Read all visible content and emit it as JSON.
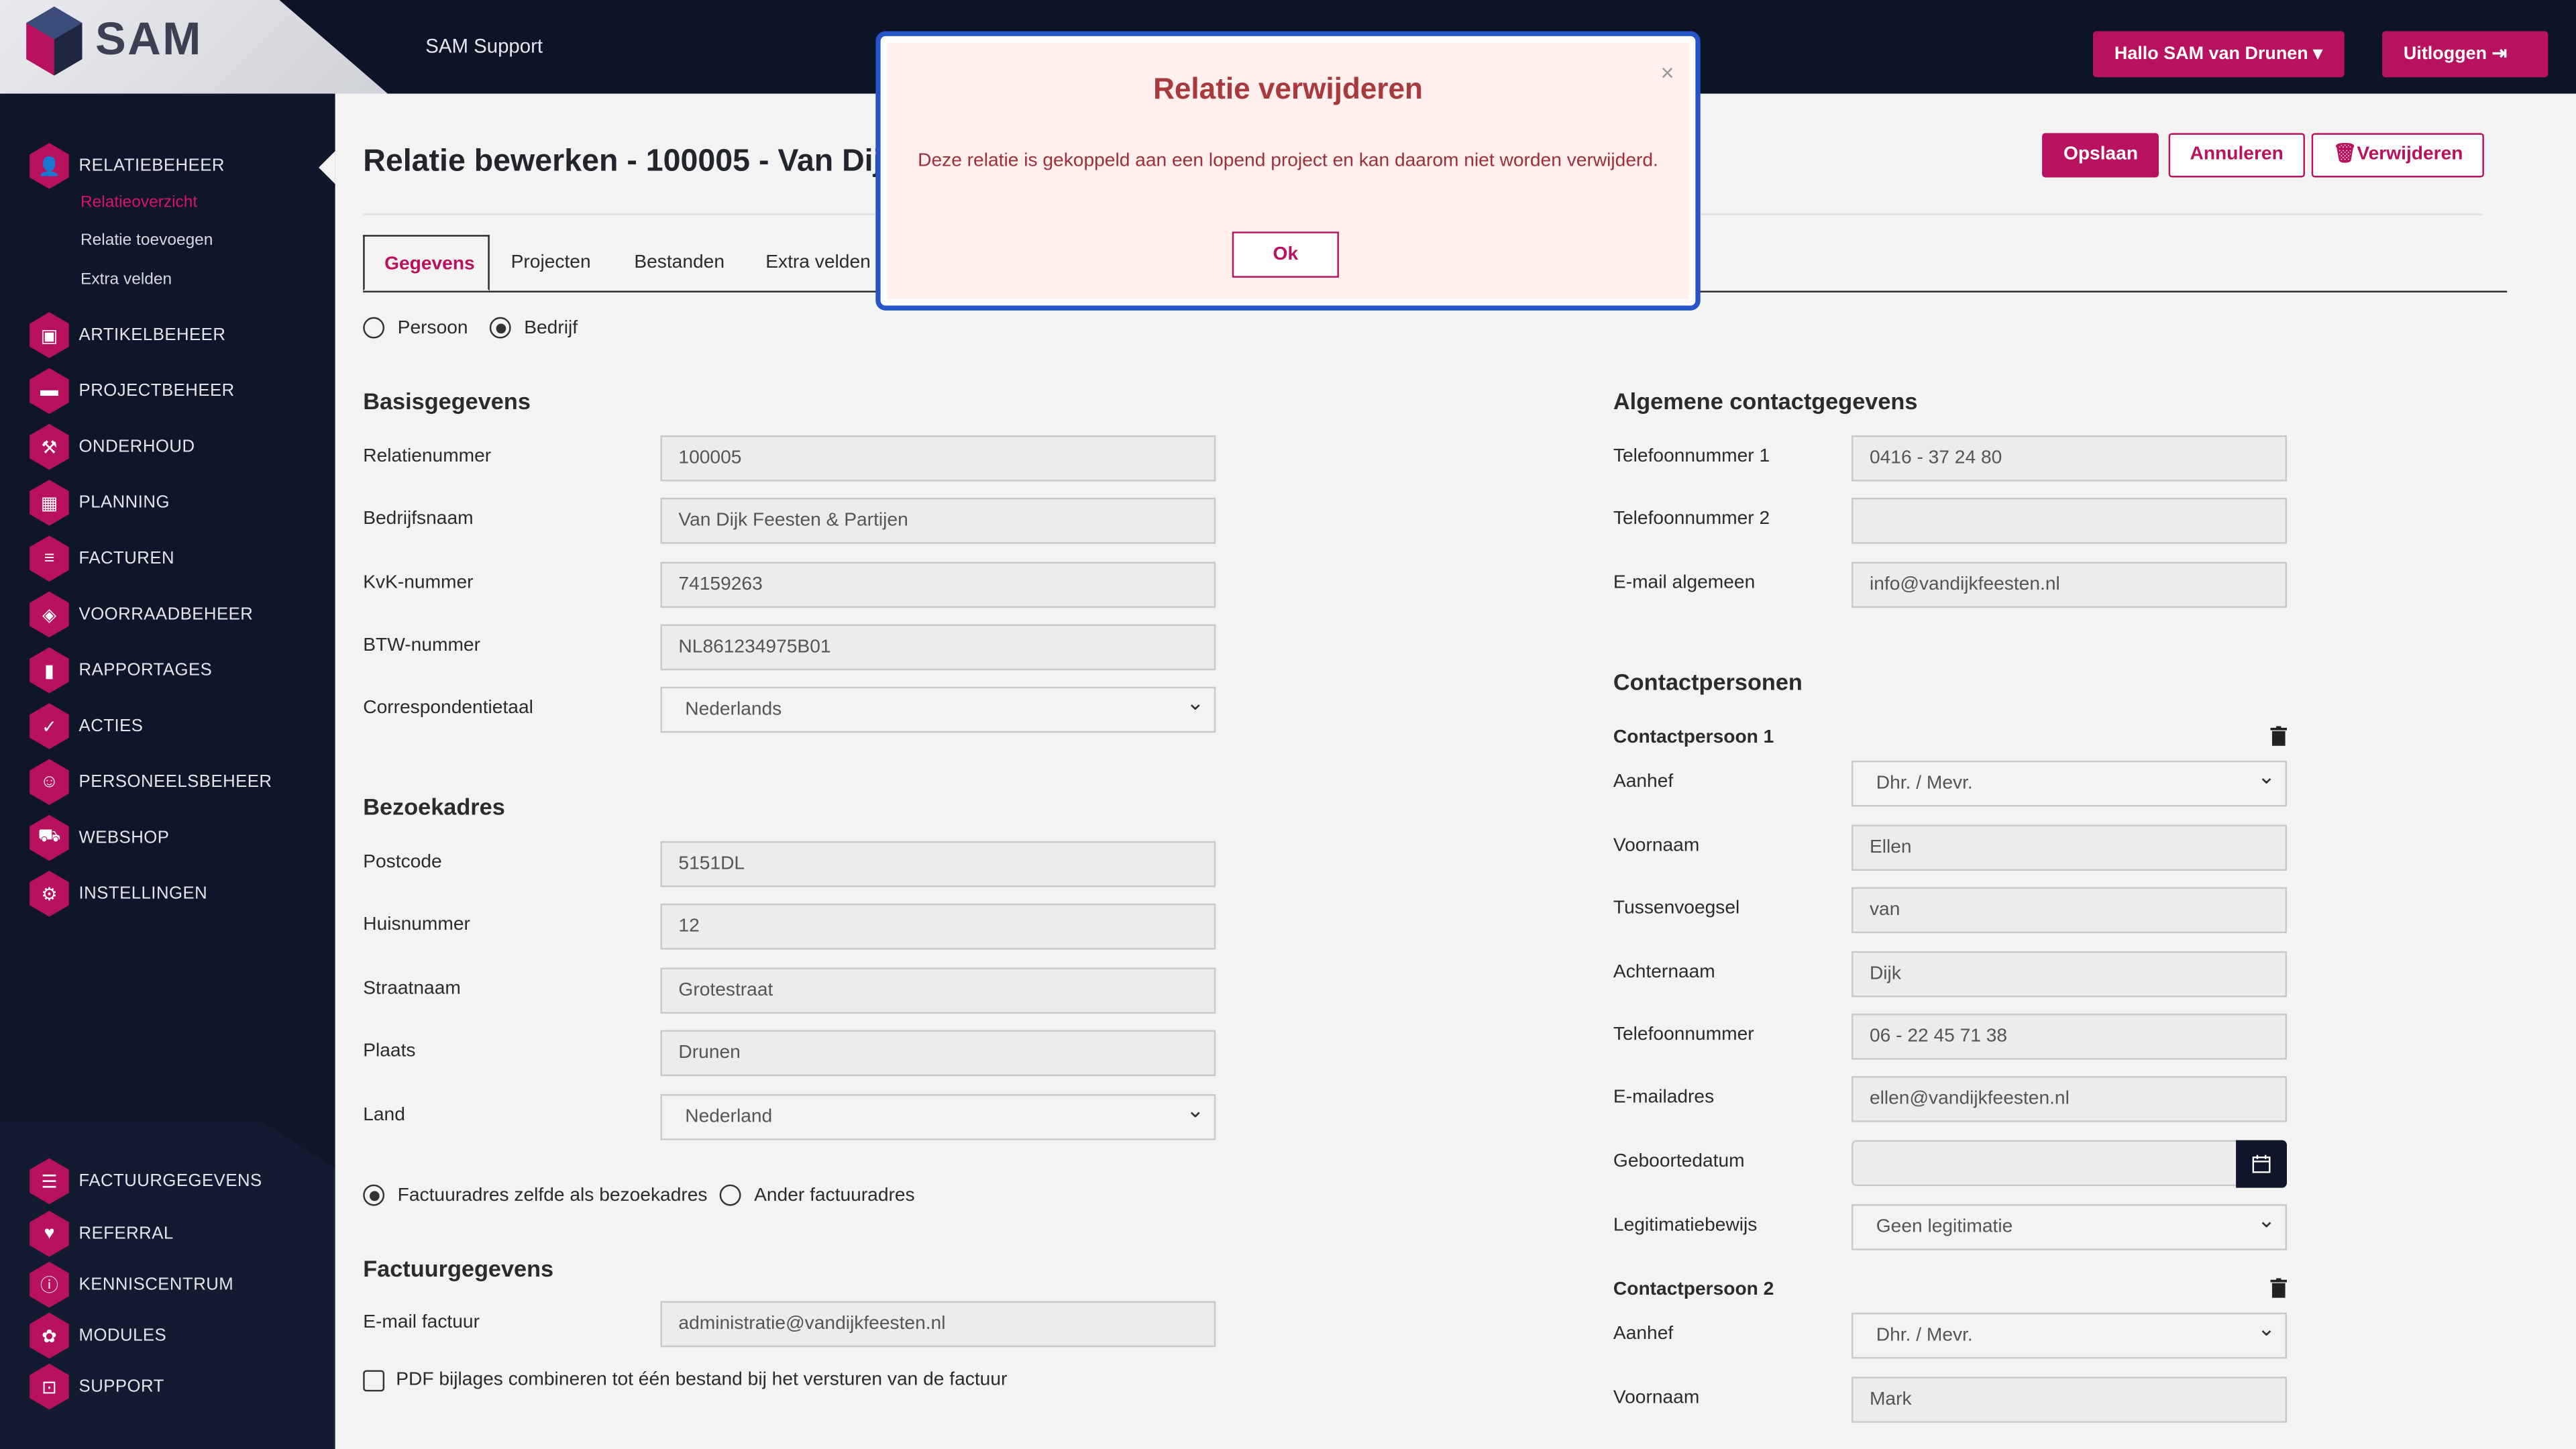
{
  "header": {
    "logo_text": "SAM",
    "support_label": "SAM Support",
    "user_menu_label": "Hallo SAM van Drunen",
    "logout_label": "Uitloggen"
  },
  "sidebar": {
    "items": [
      {
        "label": "RELATIEBEHEER",
        "icon": "user-icon"
      },
      {
        "label": "ARTIKELBEHEER",
        "icon": "box-icon"
      },
      {
        "label": "PROJECTBEHEER",
        "icon": "folder-icon"
      },
      {
        "label": "ONDERHOUD",
        "icon": "wrench-icon"
      },
      {
        "label": "PLANNING",
        "icon": "calendar-icon"
      },
      {
        "label": "FACTUREN",
        "icon": "invoice-icon"
      },
      {
        "label": "VOORRAADBEHEER",
        "icon": "stock-icon"
      },
      {
        "label": "RAPPORTAGES",
        "icon": "chart-icon"
      },
      {
        "label": "ACTIES",
        "icon": "checklist-icon"
      },
      {
        "label": "PERSONEELSBEHEER",
        "icon": "person-icon"
      },
      {
        "label": "WEBSHOP",
        "icon": "cart-icon"
      },
      {
        "label": "INSTELLINGEN",
        "icon": "gear-icon"
      }
    ],
    "subitems": [
      "Relatieoverzicht",
      "Relatie toevoegen",
      "Extra velden"
    ],
    "bottom_items": [
      {
        "label": "FACTUURGEGEVENS",
        "icon": "billing-icon"
      },
      {
        "label": "REFERRAL",
        "icon": "heart-icon"
      },
      {
        "label": "KENNISCENTRUM",
        "icon": "info-icon"
      },
      {
        "label": "MODULES",
        "icon": "modules-icon"
      },
      {
        "label": "SUPPORT",
        "icon": "ticket-icon"
      }
    ]
  },
  "page": {
    "title": "Relatie bewerken - 100005 - Van Dijk",
    "save_label": "Opslaan",
    "cancel_label": "Annuleren",
    "delete_label": "Verwijderen",
    "tabs": [
      "Gegevens",
      "Projecten",
      "Bestanden",
      "Extra velden"
    ],
    "type_options": [
      "Persoon",
      "Bedrijf"
    ]
  },
  "basis": {
    "heading": "Basisgegevens",
    "fields": [
      {
        "label": "Relatienummer",
        "value": "100005"
      },
      {
        "label": "Bedrijfsnaam",
        "value": "Van Dijk Feesten & Partijen"
      },
      {
        "label": "KvK-nummer",
        "value": "74159263"
      },
      {
        "label": "BTW-nummer",
        "value": "NL861234975B01"
      },
      {
        "label": "Correspondentietaal",
        "value": "Nederlands"
      }
    ]
  },
  "bezoek": {
    "heading": "Bezoekadres",
    "fields": [
      {
        "label": "Postcode",
        "value": "5151DL"
      },
      {
        "label": "Huisnummer",
        "value": "12"
      },
      {
        "label": "Straatnaam",
        "value": "Grotestraat"
      },
      {
        "label": "Plaats",
        "value": "Drunen"
      },
      {
        "label": "Land",
        "value": "Nederland"
      }
    ],
    "same_address_label": "Factuuradres zelfde als bezoekadres",
    "other_address_label": "Ander factuuradres"
  },
  "factuur": {
    "heading": "Factuurgegevens",
    "email_label": "E-mail factuur",
    "email_value": "administratie@vandijkfeesten.nl",
    "pdf_label": "PDF bijlages combineren tot één bestand bij het versturen van de factuur"
  },
  "algemeen": {
    "heading": "Algemene contactgegevens",
    "fields": [
      {
        "label": "Telefoonnummer 1",
        "value": "0416 - 37 24 80"
      },
      {
        "label": "Telefoonnummer 2",
        "value": ""
      },
      {
        "label": "E-mail algemeen",
        "value": "info@vandijkfeesten.nl"
      }
    ]
  },
  "contacts": {
    "heading": "Contactpersonen",
    "cp1_title": "Contactpersoon 1",
    "cp1": [
      {
        "label": "Aanhef",
        "value": "Dhr. / Mevr."
      },
      {
        "label": "Voornaam",
        "value": "Ellen"
      },
      {
        "label": "Tussenvoegsel",
        "value": "van"
      },
      {
        "label": "Achternaam",
        "value": "Dijk"
      },
      {
        "label": "Telefoonnummer",
        "value": "06 - 22 45 71 38"
      },
      {
        "label": "E-mailadres",
        "value": "ellen@vandijkfeesten.nl"
      },
      {
        "label": "Geboortedatum",
        "value": ""
      },
      {
        "label": "Legitimatiebewijs",
        "value": "Geen legitimatie"
      }
    ],
    "cp2_title": "Contactpersoon 2",
    "cp2": [
      {
        "label": "Aanhef",
        "value": "Dhr. / Mevr."
      },
      {
        "label": "Voornaam",
        "value": "Mark"
      }
    ]
  },
  "modal": {
    "title": "Relatie verwijderen",
    "message": "Deze relatie is gekoppeld aan een lopend project en kan daarom niet worden verwijderd.",
    "ok_label": "Ok",
    "close_symbol": "×"
  },
  "colors": {
    "accent": "#b8115e",
    "dark": "#0e1428",
    "modal_border": "#2456c9"
  }
}
